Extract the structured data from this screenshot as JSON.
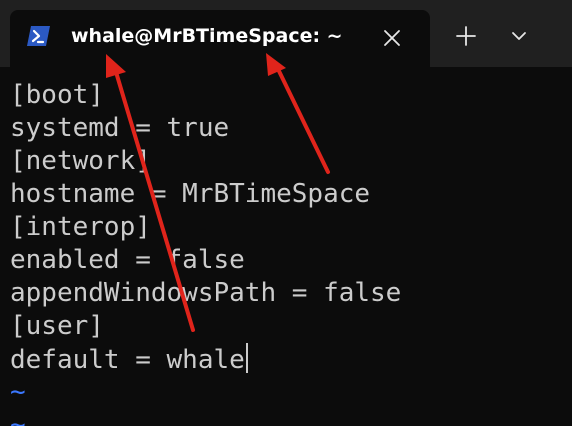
{
  "tab": {
    "icon": "powershell-icon",
    "title": "whale@MrBTimeSpace: ~",
    "close_icon": "close-icon"
  },
  "tabbar": {
    "new_tab_icon": "plus-icon",
    "dropdown_icon": "chevron-down-icon"
  },
  "terminal": {
    "lines": [
      "[boot]",
      "systemd = true",
      "[network]",
      "hostname = MrBTimeSpace",
      "[interop]",
      "enabled = false",
      "appendWindowsPath = false",
      "[user]",
      "default = whale"
    ],
    "empty_line_markers": [
      "~",
      "~"
    ]
  },
  "colors": {
    "tabbar_bg": "#202020",
    "terminal_bg": "#0c0c0c",
    "text": "#cccccc",
    "tilde": "#3b78ff",
    "annotation_arrow": "#e0241b",
    "powershell_icon": "#2b59c3"
  }
}
